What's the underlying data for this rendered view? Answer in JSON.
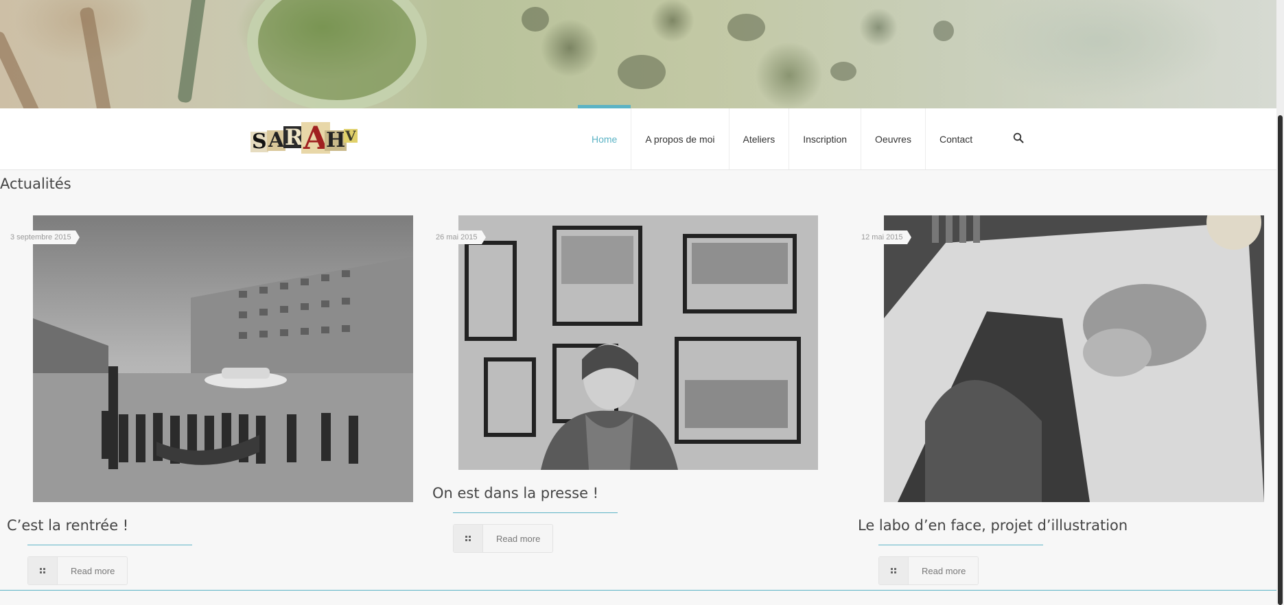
{
  "logo": {
    "letters": [
      "S",
      "A",
      "R",
      "A",
      "H",
      "V"
    ]
  },
  "nav": {
    "items": [
      {
        "label": "Home",
        "active": true
      },
      {
        "label": "A propos de moi",
        "active": false
      },
      {
        "label": "Ateliers",
        "active": false
      },
      {
        "label": "Inscription",
        "active": false
      },
      {
        "label": "Oeuvres",
        "active": false
      },
      {
        "label": "Contact",
        "active": false
      }
    ],
    "search_icon": "search-icon"
  },
  "section": {
    "title": "Actualités"
  },
  "posts": [
    {
      "date": "3 septembre 2015",
      "title": "C’est la rentrée !",
      "read_more": "Read more"
    },
    {
      "date": "26 mai 2015",
      "title": "On est dans la presse !",
      "read_more": "Read more"
    },
    {
      "date": "12 mai 2015",
      "title": "Le labo d’en face, projet d’illustration",
      "read_more": "Read more"
    }
  ],
  "colors": {
    "accent": "#5bb3c5",
    "text": "#333333",
    "background": "#f7f7f7"
  }
}
